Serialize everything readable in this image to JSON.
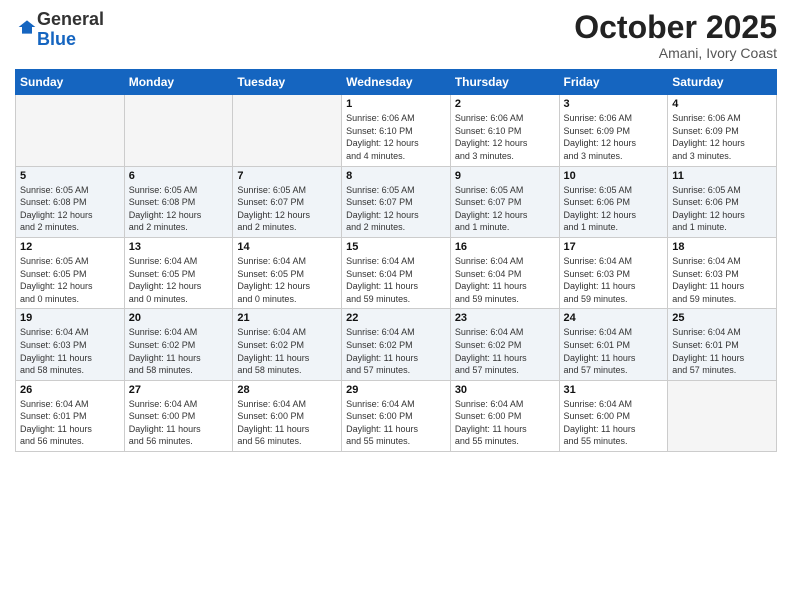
{
  "logo": {
    "general": "General",
    "blue": "Blue"
  },
  "header": {
    "month": "October 2025",
    "location": "Amani, Ivory Coast"
  },
  "weekdays": [
    "Sunday",
    "Monday",
    "Tuesday",
    "Wednesday",
    "Thursday",
    "Friday",
    "Saturday"
  ],
  "weeks": [
    [
      {
        "day": "",
        "info": ""
      },
      {
        "day": "",
        "info": ""
      },
      {
        "day": "",
        "info": ""
      },
      {
        "day": "1",
        "info": "Sunrise: 6:06 AM\nSunset: 6:10 PM\nDaylight: 12 hours\nand 4 minutes."
      },
      {
        "day": "2",
        "info": "Sunrise: 6:06 AM\nSunset: 6:10 PM\nDaylight: 12 hours\nand 3 minutes."
      },
      {
        "day": "3",
        "info": "Sunrise: 6:06 AM\nSunset: 6:09 PM\nDaylight: 12 hours\nand 3 minutes."
      },
      {
        "day": "4",
        "info": "Sunrise: 6:06 AM\nSunset: 6:09 PM\nDaylight: 12 hours\nand 3 minutes."
      }
    ],
    [
      {
        "day": "5",
        "info": "Sunrise: 6:05 AM\nSunset: 6:08 PM\nDaylight: 12 hours\nand 2 minutes."
      },
      {
        "day": "6",
        "info": "Sunrise: 6:05 AM\nSunset: 6:08 PM\nDaylight: 12 hours\nand 2 minutes."
      },
      {
        "day": "7",
        "info": "Sunrise: 6:05 AM\nSunset: 6:07 PM\nDaylight: 12 hours\nand 2 minutes."
      },
      {
        "day": "8",
        "info": "Sunrise: 6:05 AM\nSunset: 6:07 PM\nDaylight: 12 hours\nand 2 minutes."
      },
      {
        "day": "9",
        "info": "Sunrise: 6:05 AM\nSunset: 6:07 PM\nDaylight: 12 hours\nand 1 minute."
      },
      {
        "day": "10",
        "info": "Sunrise: 6:05 AM\nSunset: 6:06 PM\nDaylight: 12 hours\nand 1 minute."
      },
      {
        "day": "11",
        "info": "Sunrise: 6:05 AM\nSunset: 6:06 PM\nDaylight: 12 hours\nand 1 minute."
      }
    ],
    [
      {
        "day": "12",
        "info": "Sunrise: 6:05 AM\nSunset: 6:05 PM\nDaylight: 12 hours\nand 0 minutes."
      },
      {
        "day": "13",
        "info": "Sunrise: 6:04 AM\nSunset: 6:05 PM\nDaylight: 12 hours\nand 0 minutes."
      },
      {
        "day": "14",
        "info": "Sunrise: 6:04 AM\nSunset: 6:05 PM\nDaylight: 12 hours\nand 0 minutes."
      },
      {
        "day": "15",
        "info": "Sunrise: 6:04 AM\nSunset: 6:04 PM\nDaylight: 11 hours\nand 59 minutes."
      },
      {
        "day": "16",
        "info": "Sunrise: 6:04 AM\nSunset: 6:04 PM\nDaylight: 11 hours\nand 59 minutes."
      },
      {
        "day": "17",
        "info": "Sunrise: 6:04 AM\nSunset: 6:03 PM\nDaylight: 11 hours\nand 59 minutes."
      },
      {
        "day": "18",
        "info": "Sunrise: 6:04 AM\nSunset: 6:03 PM\nDaylight: 11 hours\nand 59 minutes."
      }
    ],
    [
      {
        "day": "19",
        "info": "Sunrise: 6:04 AM\nSunset: 6:03 PM\nDaylight: 11 hours\nand 58 minutes."
      },
      {
        "day": "20",
        "info": "Sunrise: 6:04 AM\nSunset: 6:02 PM\nDaylight: 11 hours\nand 58 minutes."
      },
      {
        "day": "21",
        "info": "Sunrise: 6:04 AM\nSunset: 6:02 PM\nDaylight: 11 hours\nand 58 minutes."
      },
      {
        "day": "22",
        "info": "Sunrise: 6:04 AM\nSunset: 6:02 PM\nDaylight: 11 hours\nand 57 minutes."
      },
      {
        "day": "23",
        "info": "Sunrise: 6:04 AM\nSunset: 6:02 PM\nDaylight: 11 hours\nand 57 minutes."
      },
      {
        "day": "24",
        "info": "Sunrise: 6:04 AM\nSunset: 6:01 PM\nDaylight: 11 hours\nand 57 minutes."
      },
      {
        "day": "25",
        "info": "Sunrise: 6:04 AM\nSunset: 6:01 PM\nDaylight: 11 hours\nand 57 minutes."
      }
    ],
    [
      {
        "day": "26",
        "info": "Sunrise: 6:04 AM\nSunset: 6:01 PM\nDaylight: 11 hours\nand 56 minutes."
      },
      {
        "day": "27",
        "info": "Sunrise: 6:04 AM\nSunset: 6:00 PM\nDaylight: 11 hours\nand 56 minutes."
      },
      {
        "day": "28",
        "info": "Sunrise: 6:04 AM\nSunset: 6:00 PM\nDaylight: 11 hours\nand 56 minutes."
      },
      {
        "day": "29",
        "info": "Sunrise: 6:04 AM\nSunset: 6:00 PM\nDaylight: 11 hours\nand 55 minutes."
      },
      {
        "day": "30",
        "info": "Sunrise: 6:04 AM\nSunset: 6:00 PM\nDaylight: 11 hours\nand 55 minutes."
      },
      {
        "day": "31",
        "info": "Sunrise: 6:04 AM\nSunset: 6:00 PM\nDaylight: 11 hours\nand 55 minutes."
      },
      {
        "day": "",
        "info": ""
      }
    ]
  ]
}
